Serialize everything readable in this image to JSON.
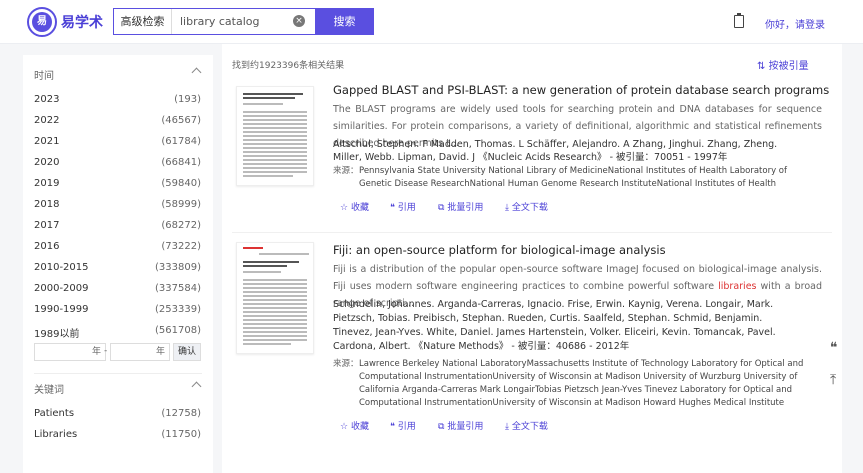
{
  "header": {
    "brand": "易学术",
    "logo_text": "易",
    "advanced": "高级检索",
    "query": "library catalog",
    "search_button": "搜索",
    "login": "你好，请登录"
  },
  "sidebar": {
    "time_title": "时间",
    "years": [
      {
        "label": "2023",
        "count": "(193)"
      },
      {
        "label": "2022",
        "count": "(46567)"
      },
      {
        "label": "2021",
        "count": "(61784)"
      },
      {
        "label": "2020",
        "count": "(66841)"
      },
      {
        "label": "2019",
        "count": "(59840)"
      },
      {
        "label": "2018",
        "count": "(58999)"
      },
      {
        "label": "2017",
        "count": "(68272)"
      },
      {
        "label": "2016",
        "count": "(73222)"
      },
      {
        "label": "2010-2015",
        "count": "(333809)"
      },
      {
        "label": "2000-2009",
        "count": "(337584)"
      },
      {
        "label": "1990-1999",
        "count": "(253339)"
      },
      {
        "label": "1989以前",
        "count": "(561708)"
      }
    ],
    "year_unit": "年",
    "dash": "-",
    "confirm": "确认",
    "keyword_title": "关键词",
    "keywords": [
      {
        "label": "Patients",
        "count": "(12758)"
      },
      {
        "label": "Libraries",
        "count": "(11750)"
      }
    ]
  },
  "results": {
    "count_text": "找到约1923396条相关结果",
    "sort_label": "按被引量",
    "source_label": "来源：",
    "actions": [
      "收藏",
      "引用",
      "批量引用",
      "全文下载"
    ],
    "items": [
      {
        "title": "Gapped BLAST and PSI-BLAST: a new generation of protein database search programs",
        "abstract": "The BLAST programs are widely used tools for searching protein and DNA databases for sequence similarities. For protein comparisons, a variety of definitional, algorithmic and statistical refinements described here permits t...",
        "authors": "Altschul, Stephen. F    Madden, Thomas. L    Schäffer, Alejandro. A    Zhang, Jinghui.    Zhang, Zheng.    Miller, Webb.    Lipman, David. J    《Nucleic Acids Research》   - 被引量：70051   - 1997年",
        "source": "Pennsylvania State University    National Library of MedicineNational Institutes of Health    Laboratory of Genetic Disease ResearchNational Human Genome Research InstituteNational Institutes of Health"
      },
      {
        "title": "Fiji: an open-source platform for biological-image analysis",
        "abstract_pre": "Fiji is a distribution of the popular open-source software ImageJ focused on biological-image analysis. Fiji uses modern software engineering practices to combine powerful software ",
        "abstract_hl": "libraries",
        "abstract_post": " with a broad range of scripti...",
        "authors": "Schindelin, Johannes.    Arganda-Carreras, Ignacio.    Frise, Erwin.    Kaynig, Verena.    Longair, Mark.    Pietzsch, Tobias.    Preibisch, Stephan.    Rueden, Curtis.    Saalfeld, Stephan.    Schmid, Benjamin.    Tinevez, Jean-Yves.    White, Daniel. James    Hartenstein, Volker.    Eliceiri, Kevin.    Tomancak, Pavel.    Cardona, Albert.    《Nature Methods》   - 被引量：40686   - 2012年",
        "source": "Lawrence Berkeley National LaboratoryMassachusetts Institute of Technology    Laboratory for Optical and Computational InstrumentationUniversity of Wisconsin at Madison    University of Wurzburg    University of California    Arganda-Carreras    Mark LongairTobias Pietzsch    Jean-Yves Tinevez    Laboratory for Optical and Computational InstrumentationUniversity of Wisconsin at Madison    Howard Hughes Medical Institute"
      }
    ]
  },
  "icons": {
    "clear": "×",
    "star": "☆",
    "quote": "❝",
    "copy": "⧉",
    "download": "⤓",
    "sort": "⇅",
    "float_quote": "❝",
    "float_top": "⤒"
  }
}
